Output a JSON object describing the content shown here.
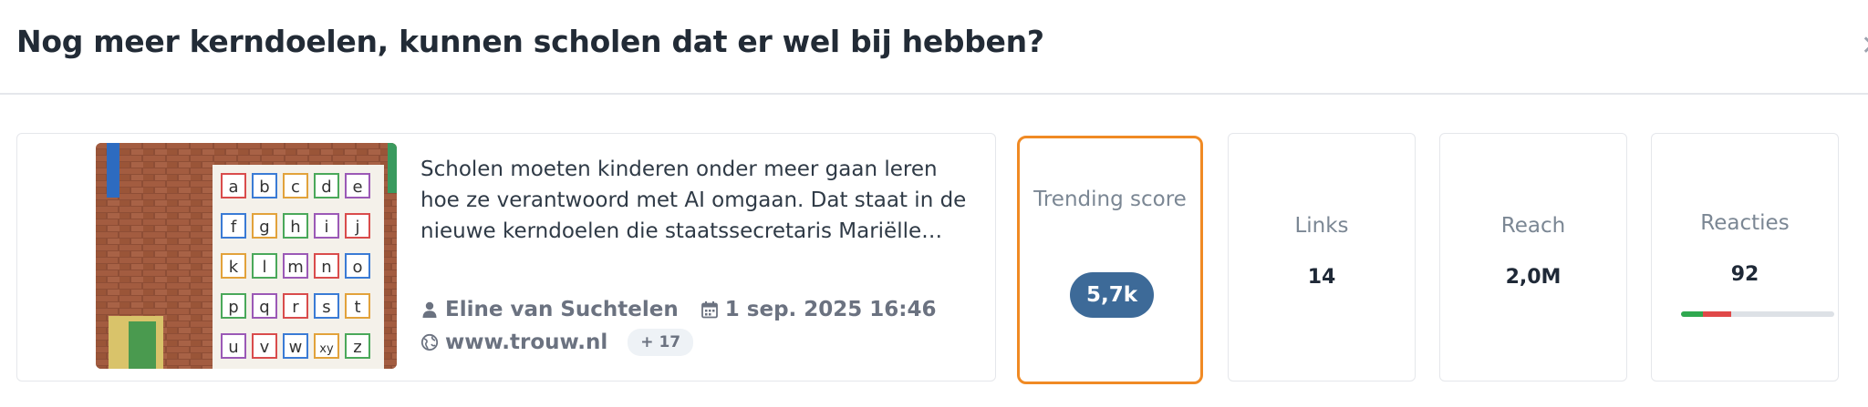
{
  "header": {
    "title": "Nog meer kerndoelen, kunnen scholen dat er wel bij hebben?",
    "close_icon": "close-icon"
  },
  "article": {
    "summary": "Scholen moeten kinderen onder meer gaan leren hoe ze verantwoord met AI omgaan. Dat staat in de nieuwe kerndoelen die staatssecretaris Mariëlle Paul…",
    "author": "Eline van Suchtelen",
    "date": "1 sep. 2025 16:46",
    "source": "www.trouw.nl",
    "more_sources": "+ 17",
    "icons": {
      "author": "user-icon",
      "date": "calendar-icon",
      "source": "globe-icon"
    },
    "thumbnail": {
      "tile_letters": [
        "a",
        "b",
        "c",
        "d",
        "e",
        "f",
        "g",
        "h",
        "i",
        "j",
        "k",
        "l",
        "m",
        "n",
        "o",
        "p",
        "q",
        "r",
        "s",
        "t",
        "u",
        "v",
        "w",
        "xy",
        "z"
      ]
    }
  },
  "stats": {
    "trending": {
      "label": "Trending score",
      "value": "5,7k"
    },
    "links": {
      "label": "Links",
      "value": "14"
    },
    "reach": {
      "label": "Reach",
      "value": "2,0M"
    },
    "reacties": {
      "label": "Reacties",
      "value": "92",
      "sentiment": {
        "positive": 0.14,
        "negative": 0.19
      }
    }
  },
  "colors": {
    "accent": "#f08a24",
    "score_pill": "#3d6a98",
    "positive": "#2fa84f",
    "negative": "#e04848",
    "neutral_track": "#dde1e6"
  }
}
